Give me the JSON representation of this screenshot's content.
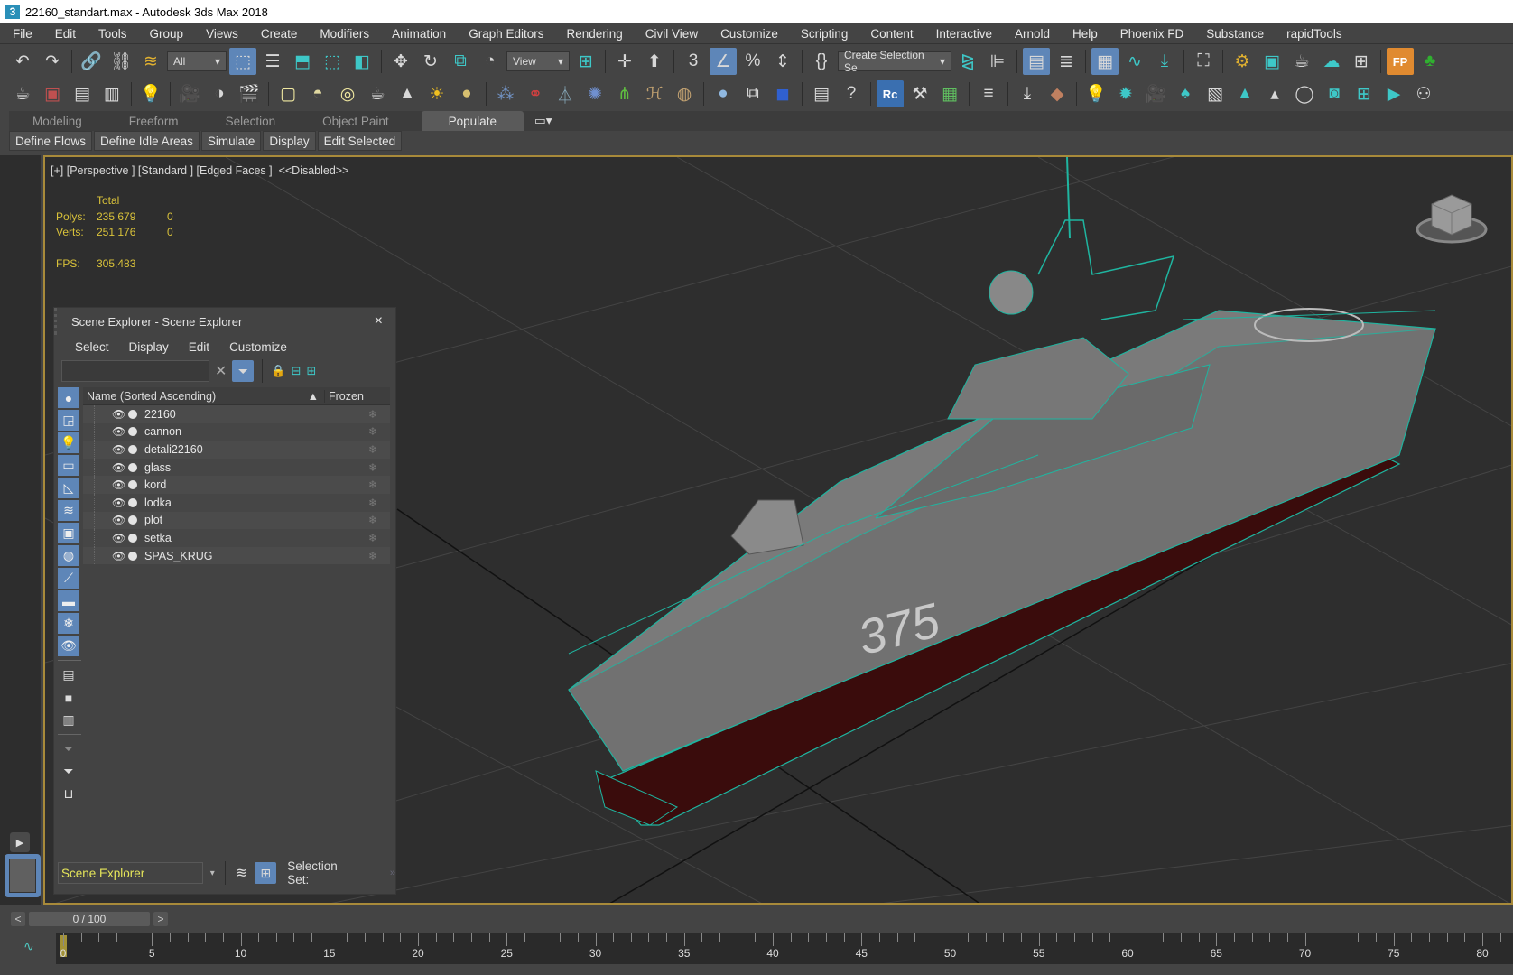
{
  "window": {
    "title": "22160_standart.max - Autodesk 3ds Max 2018",
    "app_icon": "3"
  },
  "menu": [
    "File",
    "Edit",
    "Tools",
    "Group",
    "Views",
    "Create",
    "Modifiers",
    "Animation",
    "Graph Editors",
    "Rendering",
    "Civil View",
    "Customize",
    "Scripting",
    "Content",
    "Interactive",
    "Arnold",
    "Help",
    "Phoenix FD",
    "Substance",
    "rapidTools"
  ],
  "toolbar": {
    "selection_filter": "All",
    "reference_coord": "View",
    "named_selection": "Create Selection Se"
  },
  "ribbon": {
    "tabs": [
      "Modeling",
      "Freeform",
      "Selection",
      "Object Paint",
      "Populate"
    ],
    "active_tab": "Populate",
    "buttons": [
      "Define Flows",
      "Define Idle Areas",
      "Simulate",
      "Display",
      "Edit Selected"
    ]
  },
  "viewport": {
    "label": "[+] [Perspective ] [Standard ] [Edged Faces ]  <<Disabled>>",
    "stats": {
      "header": "Total",
      "polys_label": "Polys:",
      "polys_total": "235 679",
      "polys_sel": "0",
      "verts_label": "Verts:",
      "verts_total": "251 176",
      "verts_sel": "0",
      "fps_label": "FPS:",
      "fps": "305,483"
    },
    "hull_number": "375",
    "wire_color": "#1fb5a0",
    "border_color": "#a88a3a"
  },
  "scene_explorer": {
    "title": "Scene Explorer - Scene Explorer",
    "close": "×",
    "menu": [
      "Select",
      "Display",
      "Edit",
      "Customize"
    ],
    "search_placeholder": "",
    "columns": {
      "name": "Name (Sorted Ascending)",
      "sort_arrow": "▲",
      "frozen": "Frozen"
    },
    "objects": [
      "22160",
      "cannon",
      "detali22160",
      "glass",
      "kord",
      "lodka",
      "plot",
      "setka",
      "SPAS_KRUG"
    ],
    "explorer_select": "Scene Explorer",
    "selection_set_label": "Selection Set:"
  },
  "timeline": {
    "frame_display": "0 / 100",
    "prev": "<",
    "next": ">",
    "current_frame": 0,
    "labels": [
      "0",
      "5",
      "10",
      "15",
      "20",
      "25",
      "30",
      "35",
      "40",
      "45",
      "50",
      "55",
      "60",
      "65",
      "70",
      "75",
      "80"
    ]
  }
}
